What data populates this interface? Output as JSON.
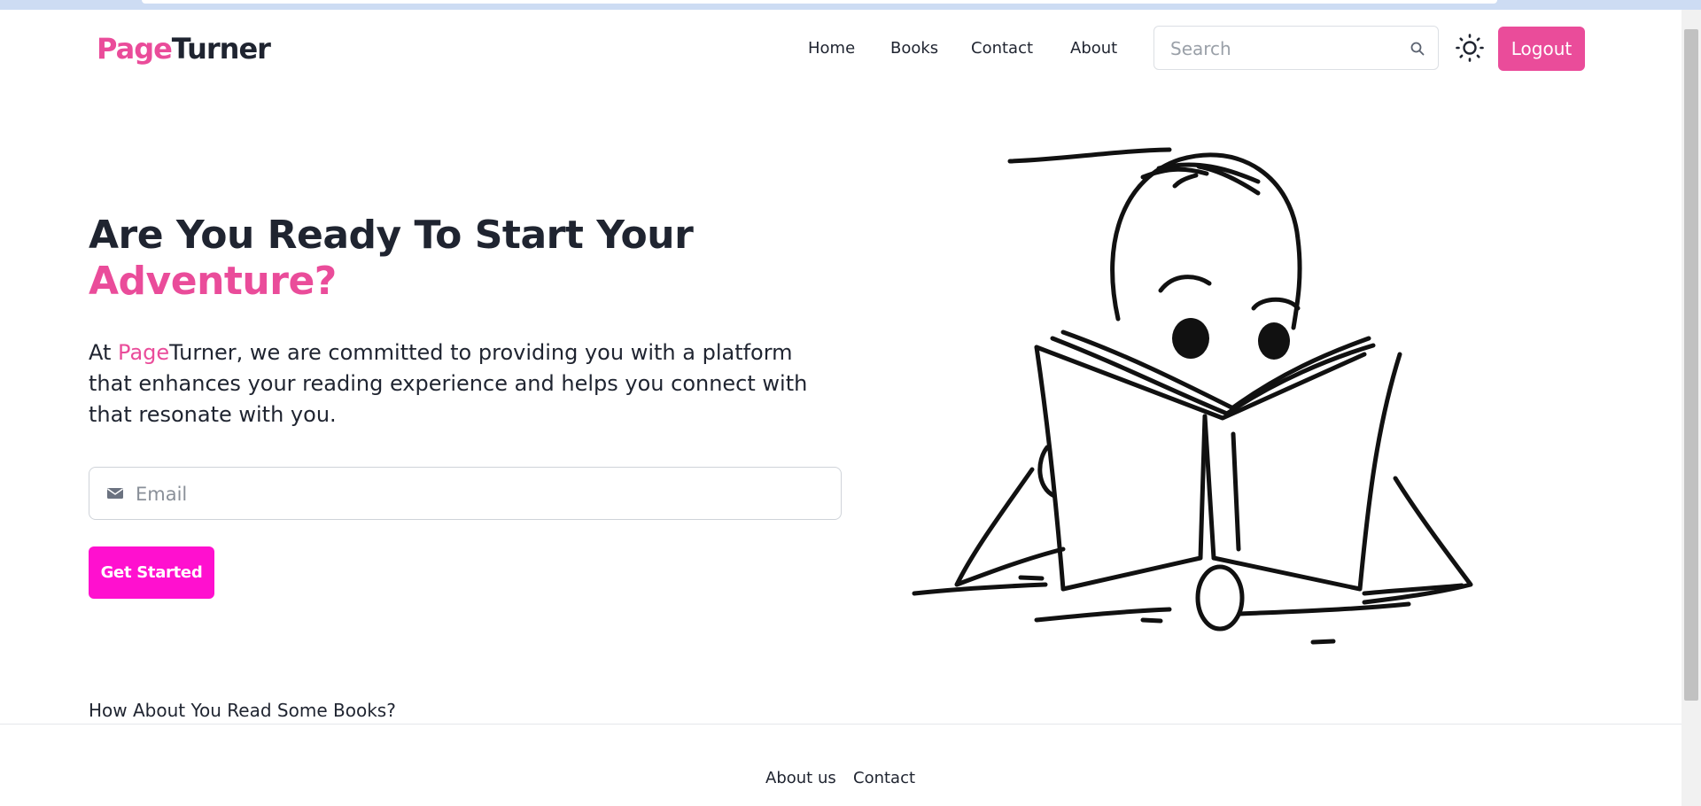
{
  "brand": {
    "part1": "Page",
    "part2": "Turner"
  },
  "nav": {
    "items": [
      {
        "label": "Home"
      },
      {
        "label": "Books"
      },
      {
        "label": "Contact"
      },
      {
        "label": "About"
      }
    ]
  },
  "search": {
    "placeholder": "Search",
    "icon": "search-icon"
  },
  "theme_toggle": {
    "icon": "sun-icon"
  },
  "logout": {
    "label": "Logout"
  },
  "hero": {
    "title_line1": "Are You Ready To Start Your",
    "title_line2": "Adventure?",
    "text_prefix": "At ",
    "text_brand_part1": "Page",
    "text_brand_part2": "Turner",
    "text_rest": ", we are committed to providing you with a platform that enhances your reading experience and helps you connect with that resonate with you."
  },
  "email": {
    "placeholder": "Email",
    "icon": "mail-icon"
  },
  "cta": {
    "label": "Get Started"
  },
  "section": {
    "heading": "How About You Read Some Books?"
  },
  "footer": {
    "links": [
      {
        "label": "About us"
      },
      {
        "label": "Contact"
      }
    ]
  },
  "colors": {
    "brand_pink": "#ea4c9a",
    "cta_magenta": "#ff10cf",
    "text_dark": "#1f2430"
  }
}
